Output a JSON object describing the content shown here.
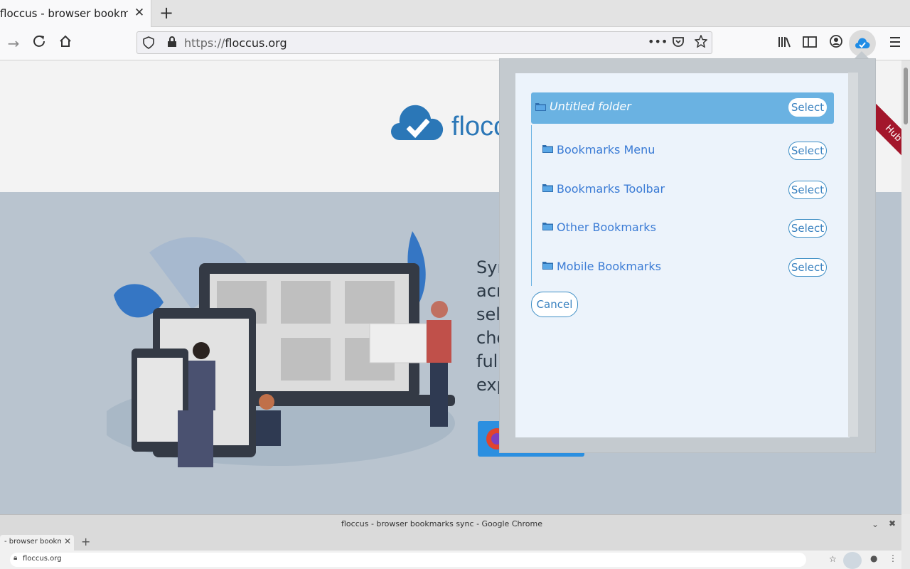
{
  "firefox": {
    "tab": {
      "title": "floccus - browser bookmarks sync",
      "close": "✕"
    },
    "newtab": "+",
    "url": {
      "scheme": "https://",
      "host": "floccus.org"
    }
  },
  "page": {
    "logo_text": "flocc",
    "hero_text_lines": [
      "Syn",
      "acr",
      "sel",
      "cho",
      "full",
      "exp"
    ],
    "ribbon": "Hub"
  },
  "popup": {
    "selected": {
      "label": "Untitled folder",
      "select_label": "Select"
    },
    "folders": [
      {
        "label": "Bookmarks Menu",
        "select_label": "Select"
      },
      {
        "label": "Bookmarks Toolbar",
        "select_label": "Select"
      },
      {
        "label": "Other Bookmarks",
        "select_label": "Select"
      },
      {
        "label": "Mobile Bookmarks",
        "select_label": "Select"
      }
    ],
    "cancel_label": "Cancel"
  },
  "chrome": {
    "title": "floccus - browser bookmarks sync - Google Chrome",
    "tab_title": "- browser bookma",
    "url": "floccus.org"
  },
  "colors": {
    "accent": "#3a82c0",
    "selected_row": "#6ab2e2",
    "cloud_icon": "#1f8ce6",
    "logo": "#2b77b7"
  }
}
